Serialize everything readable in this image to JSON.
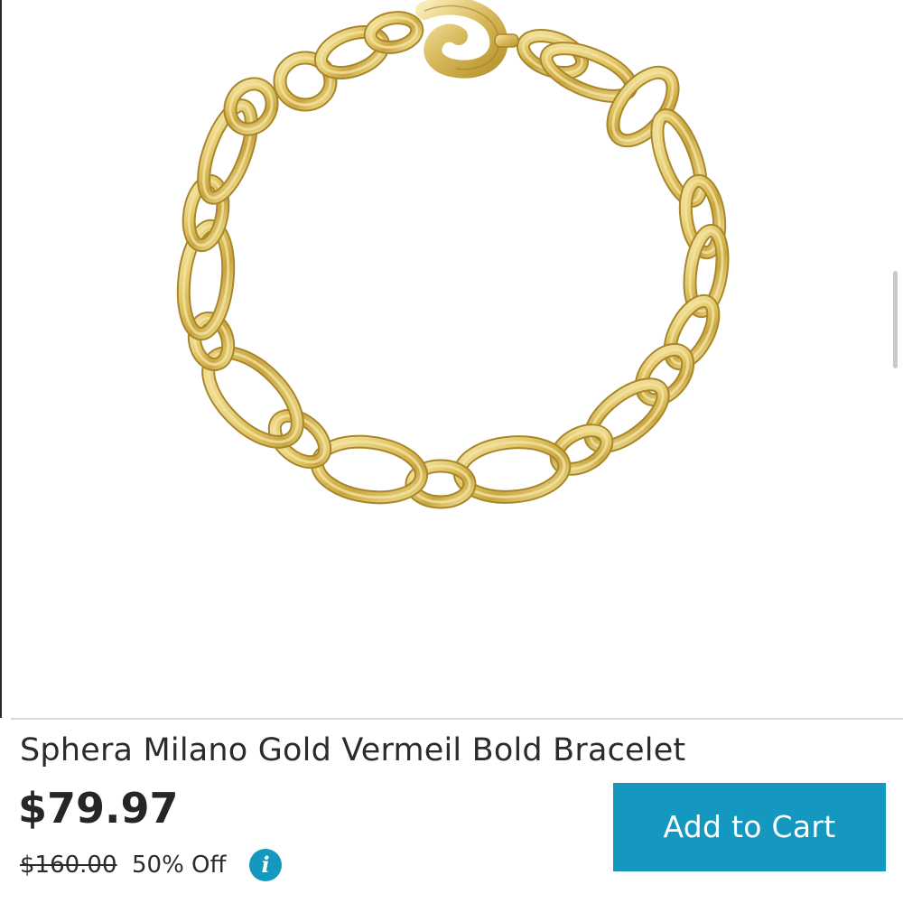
{
  "colors": {
    "accent": "#1498C0",
    "gold_dark": "#A8862A",
    "gold_light": "#F3E3A0"
  },
  "product": {
    "title": "Sphera Milano Gold Vermeil Bold Bracelet",
    "image_icon": "gold-chain-bracelet"
  },
  "pricing": {
    "current_price": "$79.97",
    "original_price": "$160.00",
    "discount": "50% Off",
    "info_glyph": "i"
  },
  "actions": {
    "add_to_cart_label": "Add to Cart"
  }
}
